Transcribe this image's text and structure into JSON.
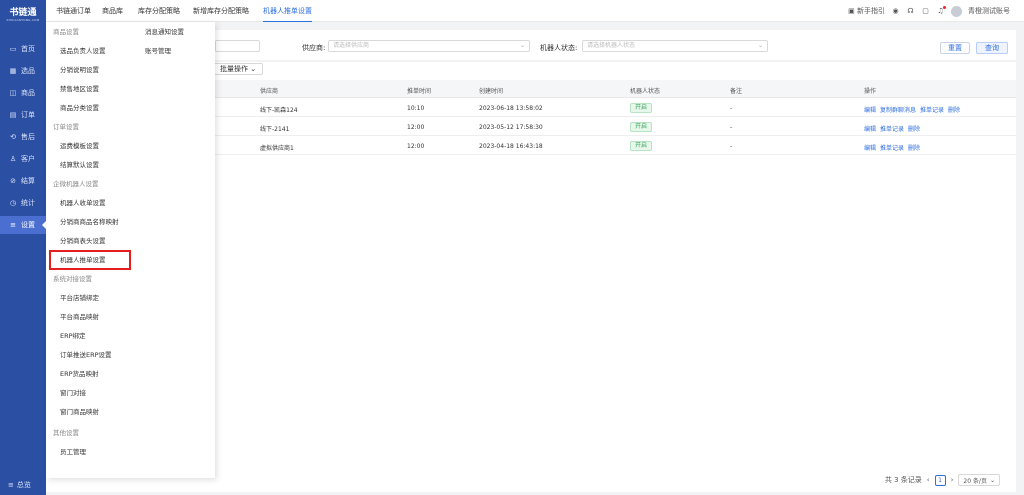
{
  "app": {
    "logo_title": "书链通",
    "logo_sub": "SHULIANTONG.COM"
  },
  "sidebar": {
    "items": [
      {
        "label": "首页",
        "icon": "monitor-icon"
      },
      {
        "label": "选品",
        "icon": "grid-icon"
      },
      {
        "label": "商品",
        "icon": "bag-icon"
      },
      {
        "label": "订单",
        "icon": "order-icon"
      },
      {
        "label": "售后",
        "icon": "aftersale-icon"
      },
      {
        "label": "客户",
        "icon": "users-icon"
      },
      {
        "label": "结算",
        "icon": "settle-icon"
      },
      {
        "label": "统计",
        "icon": "stats-icon"
      },
      {
        "label": "设置",
        "icon": "settings-icon"
      }
    ],
    "footer": "总览"
  },
  "topbar": {
    "tabs": [
      "书链通订单",
      "商品库",
      "库存分配策略",
      "新增库存分配策略",
      "机器人推单设置"
    ],
    "active_tab": "机器人推单设置",
    "guide": "新手指引",
    "username": "青橙测试账号"
  },
  "filters": {
    "supplier_label": "供应商:",
    "supplier_placeholder": "请选择供应商",
    "robot_status_label": "机器人状态:",
    "robot_status_placeholder": "请选择机器人状态",
    "reset": "重置",
    "query": "查询"
  },
  "table": {
    "bulk_label": "批量操作",
    "headers": [
      "供应商",
      "推单时间",
      "创建时间",
      "机器人状态",
      "备注",
      "操作"
    ],
    "rows": [
      {
        "supplier": "线下-凯森124",
        "time": "10:10",
        "created": "2023-06-18 13:58:02",
        "status": "开启",
        "note": "-",
        "actions": [
          "编辑",
          "复制群聊消息",
          "推单记录",
          "删除"
        ]
      },
      {
        "supplier": "线下-2141",
        "time": "12:00",
        "created": "2023-05-12 17:58:30",
        "status": "开启",
        "note": "-",
        "actions": [
          "编辑",
          "推单记录",
          "删除"
        ]
      },
      {
        "supplier": "虚拟供应商1",
        "time": "12:00",
        "created": "2023-04-18 16:43:18",
        "status": "开启",
        "note": "-",
        "actions": [
          "编辑",
          "推单记录",
          "删除"
        ]
      }
    ]
  },
  "pagination": {
    "total": "共 3 条记录",
    "page": "1",
    "size": "20 条/页"
  },
  "menu": {
    "col2": [
      "消息通知设置",
      "账号管理"
    ],
    "sections": [
      {
        "title": "商品设置",
        "items": [
          "选品负责人设置",
          "分销说明设置",
          "禁售地区设置",
          "商品分类设置"
        ]
      },
      {
        "title": "订单设置",
        "items": [
          "运费模板设置",
          "结算默认设置"
        ]
      },
      {
        "title": "企微机器人设置",
        "items": [
          "机器人收单设置",
          "分销商商品名称映射",
          "分销商表头设置",
          "机器人推单设置"
        ]
      },
      {
        "title": "系统对接设置",
        "items": [
          "平台店铺绑定",
          "平台商品映射",
          "ERP绑定",
          "订单推送ERP设置",
          "ERP货品映射",
          "窗门对接",
          "窗门商品映射"
        ]
      },
      {
        "title": "其他设置",
        "items": [
          "员工管理"
        ]
      }
    ]
  }
}
